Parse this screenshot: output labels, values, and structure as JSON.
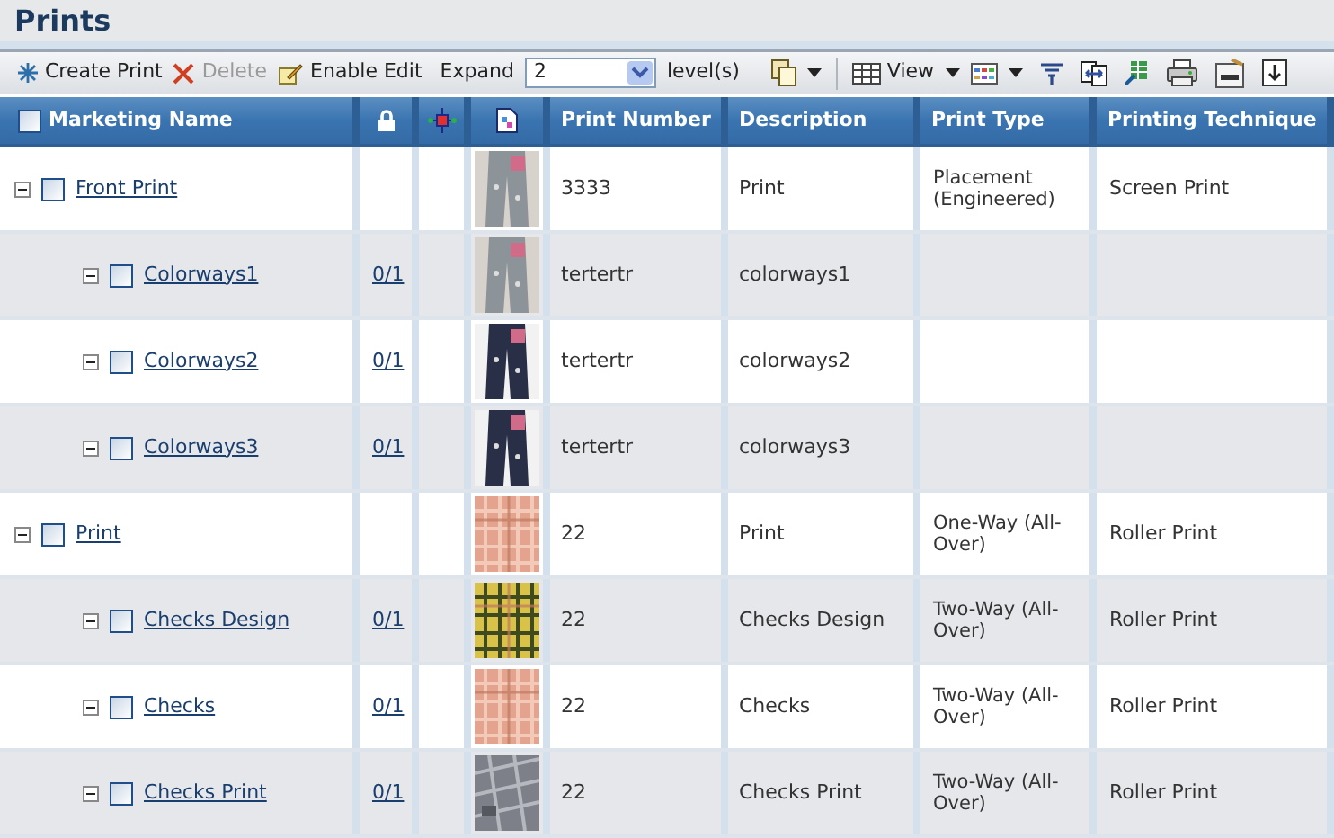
{
  "page": {
    "title": "Prints"
  },
  "toolbar": {
    "create": "Create Print",
    "delete": {
      "label": "Delete",
      "disabled": true
    },
    "edit": "Enable Edit",
    "expand_label": "Expand",
    "expand_value": "2",
    "levels_label": "level(s)",
    "view": "View"
  },
  "table": {
    "all_checked": false,
    "columns": [
      "Marketing Name",
      "Print Number",
      "Description",
      "Print Type",
      "Printing Technique"
    ],
    "rows": [
      {
        "name": "Front Print",
        "expanded": true,
        "checked": false,
        "print_number": "3333",
        "description": "Print",
        "print_type": "Placement (Engineered)",
        "technique": "Screen Print",
        "children": [
          {
            "name": "Colorways1",
            "expanded": true,
            "checked": false,
            "count": "0/1",
            "print_number": "tertertr",
            "description": "colorways1"
          },
          {
            "name": "Colorways2",
            "expanded": true,
            "checked": false,
            "count": "0/1",
            "print_number": "tertertr",
            "description": "colorways2"
          },
          {
            "name": "Colorways3",
            "expanded": true,
            "checked": false,
            "count": "0/1",
            "print_number": "tertertr",
            "description": "colorways3"
          }
        ]
      },
      {
        "name": "Print",
        "expanded": true,
        "checked": false,
        "print_number": "22",
        "description": "Print",
        "print_type": "One-Way (All-Over)",
        "technique": "Roller Print",
        "children": [
          {
            "name": "Checks Design",
            "expanded": true,
            "checked": false,
            "count": "0/1",
            "print_number": "22",
            "description": "Checks Design",
            "print_type": "Two-Way (All-Over)",
            "technique": "Roller Print"
          },
          {
            "name": "Checks",
            "expanded": true,
            "checked": false,
            "count": "0/1",
            "print_number": "22",
            "description": "Checks",
            "print_type": "Two-Way (All-Over)",
            "technique": "Roller Print"
          },
          {
            "name": "Checks Print",
            "expanded": true,
            "checked": false,
            "count": "0/1",
            "print_number": "22",
            "description": "Checks Print",
            "print_type": "Two-Way (All-Over)",
            "technique": "Roller Print"
          }
        ]
      }
    ]
  }
}
